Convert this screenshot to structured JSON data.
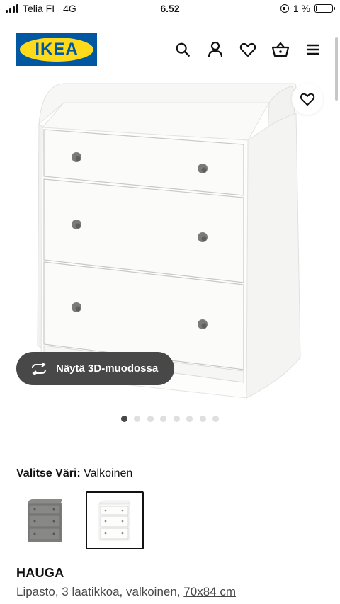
{
  "status_bar": {
    "carrier": "Telia FI",
    "network": "4G",
    "time": "6.52",
    "battery_text": "1 %",
    "battery_level": 0.01
  },
  "header": {
    "logo_text": "IKEA",
    "icons": [
      "search-icon",
      "account-icon",
      "favourites-icon",
      "cart-icon",
      "menu-icon"
    ]
  },
  "gallery": {
    "view_3d_label": "Näytä 3D-muodossa",
    "dot_count": 8,
    "active_dot": 0
  },
  "color": {
    "label": "Valitse Väri:",
    "value": "Valkoinen",
    "options": [
      "grey",
      "white"
    ],
    "selected_index": 1
  },
  "product": {
    "name": "HAUGA",
    "description": "Lipasto, 3 laatikkoa, valkoinen,",
    "size": "70x84 cm"
  },
  "colors": {
    "brand_blue": "#0058a3",
    "brand_yellow": "#ffda1a",
    "pill_bg": "#484848"
  }
}
